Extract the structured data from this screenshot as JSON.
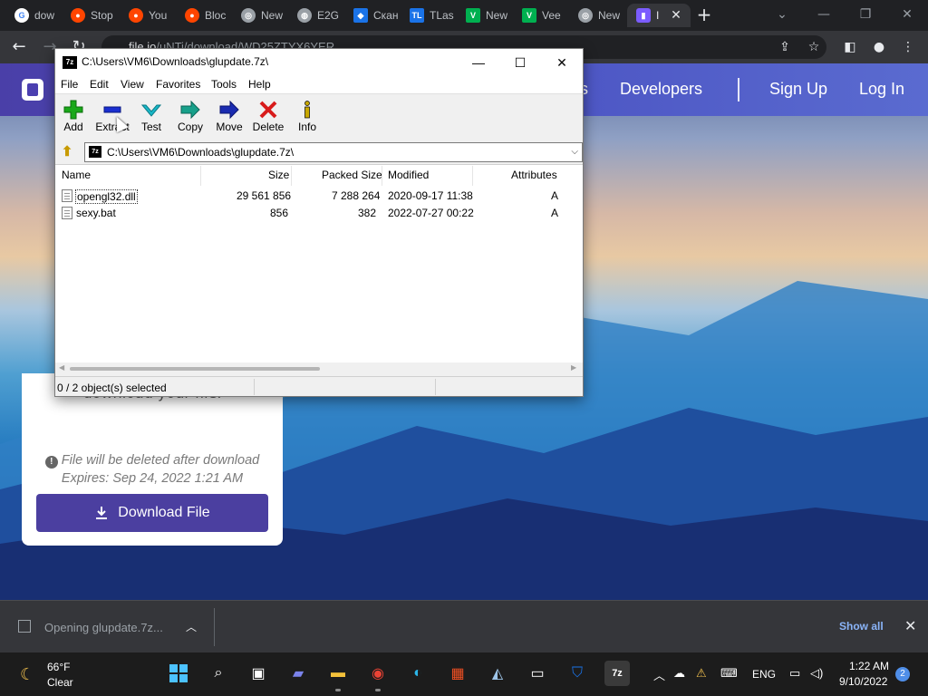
{
  "browser": {
    "tabs": [
      {
        "label": "dow",
        "color": "#ffffff",
        "icon": "google-icon"
      },
      {
        "label": "Stop",
        "color": "#ff4500",
        "icon": "reddit-icon"
      },
      {
        "label": "You",
        "color": "#ff4500",
        "icon": "reddit-icon"
      },
      {
        "label": "Bloc",
        "color": "#ff4500",
        "icon": "reddit-icon"
      },
      {
        "label": "New",
        "color": "#9aa0a6",
        "icon": "chrome-icon"
      },
      {
        "label": "E2G",
        "color": "#9aa0a6",
        "icon": "globe-icon"
      },
      {
        "label": "Скан",
        "color": "#1a73e8",
        "icon": "virustotal-icon"
      },
      {
        "label": "TLas",
        "color": "#1a73e8",
        "icon": "tl-icon"
      },
      {
        "label": "New",
        "color": "#00b050",
        "icon": "v-icon"
      },
      {
        "label": "Vee",
        "color": "#00b050",
        "icon": "v-icon"
      },
      {
        "label": "New",
        "color": "#9aa0a6",
        "icon": "chrome-icon"
      },
      {
        "label": "I",
        "color": "#7b5cff",
        "icon": "fileio-icon"
      }
    ],
    "url_host": "file.io",
    "url_path": "/uNTi/download/WD25ZTYX6YER"
  },
  "site": {
    "nav": [
      {
        "label": "s"
      },
      {
        "label": "Developers"
      },
      {
        "label": "Sign Up"
      },
      {
        "label": "Log In"
      }
    ],
    "card_message": "download your file.",
    "note_line1": "File will be deleted after download",
    "note_line2": "Expires: Sep 24, 2022 1:21 AM",
    "download_label": "Download File"
  },
  "sevenzip": {
    "title": "C:\\Users\\VM6\\Downloads\\glupdate.7z\\",
    "app_icon": "7z",
    "menu": [
      "File",
      "Edit",
      "View",
      "Favorites",
      "Tools",
      "Help"
    ],
    "tools": [
      {
        "label": "Add",
        "icon": "plus-icon",
        "color": "#1aa81a"
      },
      {
        "label": "Extract",
        "icon": "minus-icon",
        "color": "#1a2fd0"
      },
      {
        "label": "Test",
        "icon": "check-icon",
        "color": "#18b8c8"
      },
      {
        "label": "Copy",
        "icon": "copy-arrow-icon",
        "color": "#17a08a"
      },
      {
        "label": "Move",
        "icon": "move-arrow-icon",
        "color": "#1a2bb0"
      },
      {
        "label": "Delete",
        "icon": "delete-x-icon",
        "color": "#d81b1b"
      },
      {
        "label": "Info",
        "icon": "info-icon",
        "color": "#c8a800"
      }
    ],
    "address": "C:\\Users\\VM6\\Downloads\\glupdate.7z\\",
    "columns": [
      "Name",
      "Size",
      "Packed Size",
      "Modified",
      "Attributes"
    ],
    "files": [
      {
        "name": "opengl32.dll",
        "size": "29 561 856",
        "packed": "7 288 264",
        "modified": "2020-09-17 11:38",
        "attr": "A"
      },
      {
        "name": "sexy.bat",
        "size": "856",
        "packed": "382",
        "modified": "2022-07-27 00:22",
        "attr": "A"
      }
    ],
    "status": "0 / 2 object(s) selected"
  },
  "download_bar": {
    "file": "Opening glupdate.7z...",
    "show_all": "Show all"
  },
  "taskbar": {
    "temp": "66°F",
    "condition": "Clear",
    "lang": "ENG",
    "time": "1:22 AM",
    "date": "9/10/2022",
    "notifications": "2"
  }
}
